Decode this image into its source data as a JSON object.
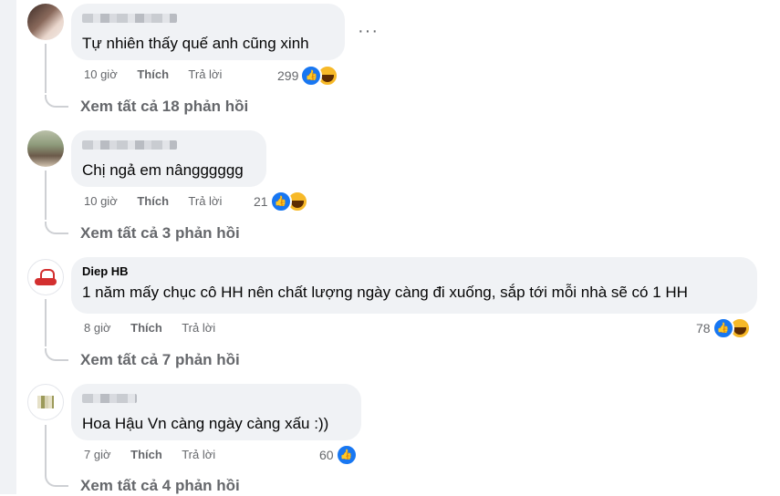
{
  "comments": [
    {
      "author": "",
      "text": "Tự nhiên thấy quế anh cũng xinh",
      "time": "10 giờ",
      "like_label": "Thích",
      "reply_label": "Trả lời",
      "reaction_count": "299",
      "reactions": [
        "like-icon",
        "haha-icon"
      ],
      "view_replies": "Xem tất cả 18 phản hồi"
    },
    {
      "author": "",
      "text": "Chị ngả em nângggggg",
      "time": "10 giờ",
      "like_label": "Thích",
      "reply_label": "Trả lời",
      "reaction_count": "21",
      "reactions": [
        "like-icon",
        "haha-icon"
      ],
      "view_replies": "Xem tất cả 3 phản hồi"
    },
    {
      "author": "Diep HB",
      "text": "1 năm mấy chục cô HH nên chất lượng ngày càng đi xuống, sắp tới mỗi nhà sẽ có 1 HH",
      "time": "8 giờ",
      "like_label": "Thích",
      "reply_label": "Trả lời",
      "reaction_count": "78",
      "reactions": [
        "like-icon",
        "haha-icon"
      ],
      "view_replies": "Xem tất cả 7 phản hồi"
    },
    {
      "author": "",
      "text": "Hoa Hậu Vn càng ngày càng xấu :))",
      "time": "7 giờ",
      "like_label": "Thích",
      "reply_label": "Trả lời",
      "reaction_count": "60",
      "reactions": [
        "like-icon"
      ],
      "view_replies": "Xem tất cả 4 phản hồi"
    }
  ],
  "more_options": "···",
  "colors": {
    "bubble": "#f0f2f5",
    "like": "#1877f2",
    "haha": "#f7b928",
    "secondary_text": "#65676b"
  }
}
